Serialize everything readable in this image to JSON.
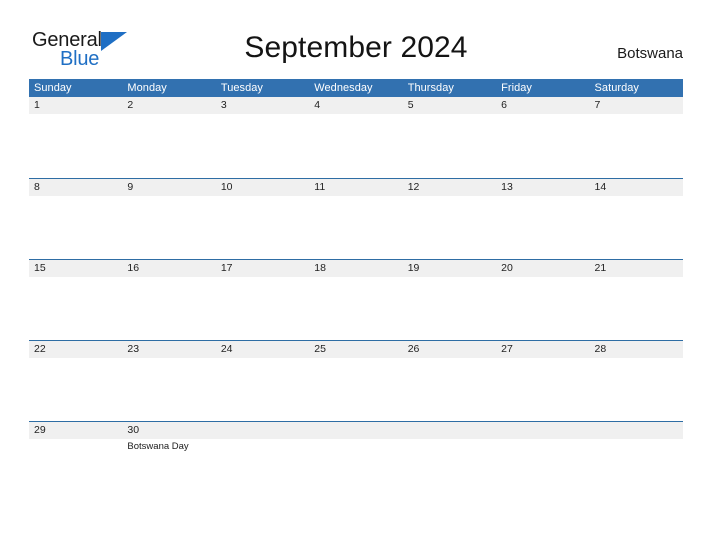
{
  "brand": {
    "name_top": "General",
    "name_bottom": "Blue",
    "flag_icon": "blue-triangle-flag-icon",
    "color_text": "#1a1a1a",
    "color_accent": "#1f6fc4"
  },
  "header": {
    "title": "September 2024",
    "country": "Botswana"
  },
  "theme": {
    "header_blue": "#3271b0",
    "row_rule_blue": "#2e6da4",
    "date_band_gray": "#f0f0f0",
    "page_background": "#ffffff"
  },
  "calendar": {
    "weekdays": [
      "Sunday",
      "Monday",
      "Tuesday",
      "Wednesday",
      "Thursday",
      "Friday",
      "Saturday"
    ],
    "weeks": [
      {
        "days": [
          {
            "date": "1",
            "events": []
          },
          {
            "date": "2",
            "events": []
          },
          {
            "date": "3",
            "events": []
          },
          {
            "date": "4",
            "events": []
          },
          {
            "date": "5",
            "events": []
          },
          {
            "date": "6",
            "events": []
          },
          {
            "date": "7",
            "events": []
          }
        ]
      },
      {
        "days": [
          {
            "date": "8",
            "events": []
          },
          {
            "date": "9",
            "events": []
          },
          {
            "date": "10",
            "events": []
          },
          {
            "date": "11",
            "events": []
          },
          {
            "date": "12",
            "events": []
          },
          {
            "date": "13",
            "events": []
          },
          {
            "date": "14",
            "events": []
          }
        ]
      },
      {
        "days": [
          {
            "date": "15",
            "events": []
          },
          {
            "date": "16",
            "events": []
          },
          {
            "date": "17",
            "events": []
          },
          {
            "date": "18",
            "events": []
          },
          {
            "date": "19",
            "events": []
          },
          {
            "date": "20",
            "events": []
          },
          {
            "date": "21",
            "events": []
          }
        ]
      },
      {
        "days": [
          {
            "date": "22",
            "events": []
          },
          {
            "date": "23",
            "events": []
          },
          {
            "date": "24",
            "events": []
          },
          {
            "date": "25",
            "events": []
          },
          {
            "date": "26",
            "events": []
          },
          {
            "date": "27",
            "events": []
          },
          {
            "date": "28",
            "events": []
          }
        ]
      },
      {
        "days": [
          {
            "date": "29",
            "events": []
          },
          {
            "date": "30",
            "events": [
              "Botswana Day"
            ]
          },
          {
            "date": "",
            "events": []
          },
          {
            "date": "",
            "events": []
          },
          {
            "date": "",
            "events": []
          },
          {
            "date": "",
            "events": []
          },
          {
            "date": "",
            "events": []
          }
        ]
      }
    ]
  }
}
